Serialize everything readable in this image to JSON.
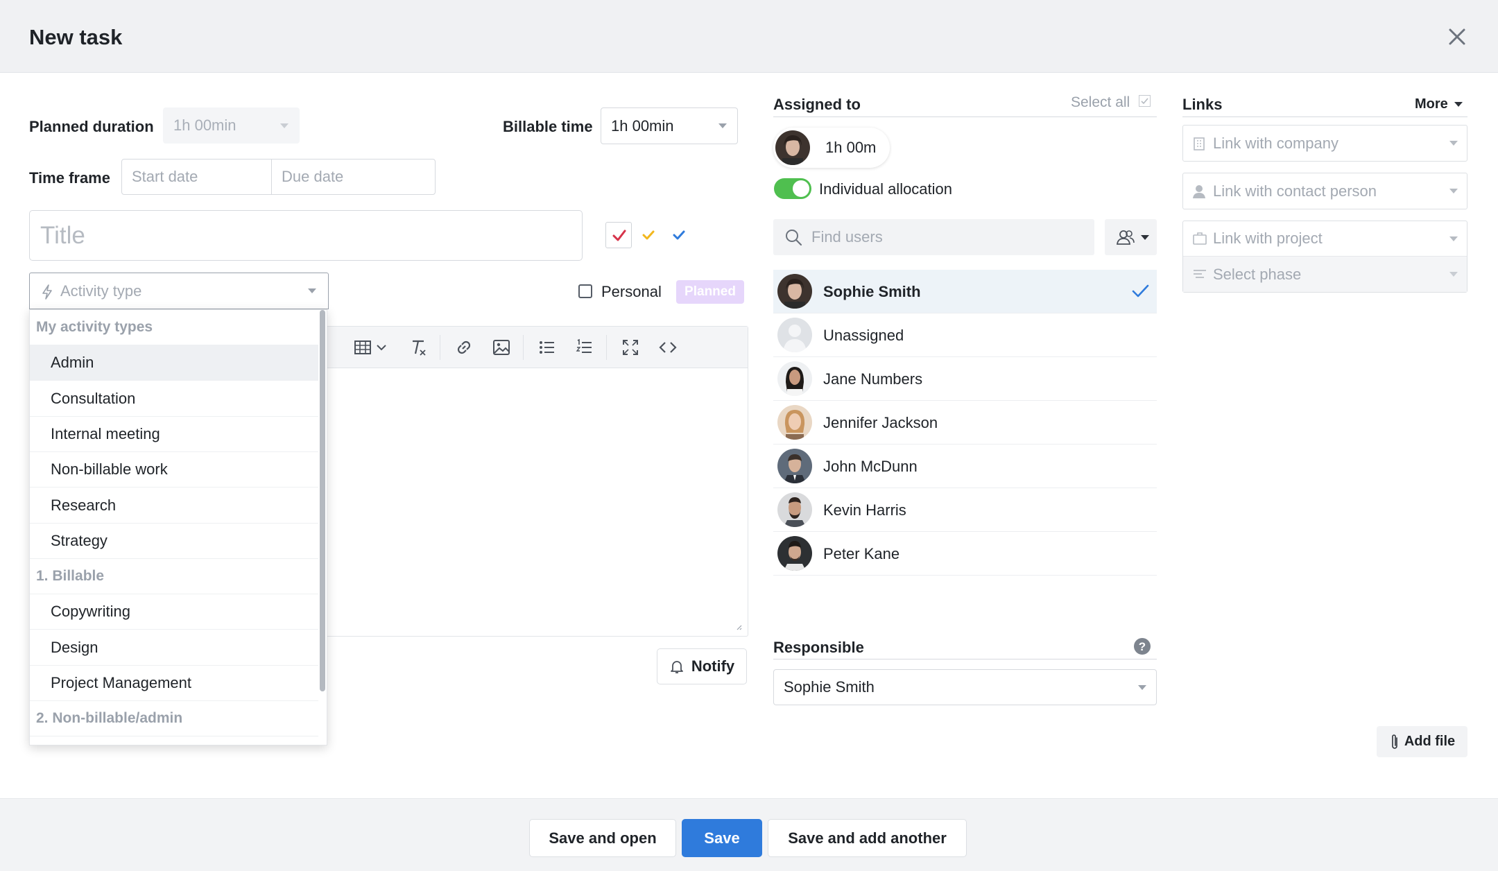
{
  "dialog": {
    "title": "New task"
  },
  "form": {
    "planned_duration": {
      "label": "Planned duration",
      "value": "1h 00min"
    },
    "billable_time": {
      "label": "Billable time",
      "value": "1h 00min"
    },
    "time_frame": {
      "label": "Time frame",
      "start_placeholder": "Start date",
      "due_placeholder": "Due date"
    },
    "title_placeholder": "Title",
    "activity_type_placeholder": "Activity type",
    "personal_label": "Personal",
    "planned_badge": "Planned",
    "notify_label": "Notify",
    "status_colors": {
      "red": "#d6334a",
      "yellow": "#f2b71e",
      "blue": "#2f7bdc"
    }
  },
  "activity_menu": [
    {
      "kind": "group",
      "label": "My activity types"
    },
    {
      "kind": "item",
      "label": "Admin",
      "highlighted": true
    },
    {
      "kind": "item",
      "label": "Consultation"
    },
    {
      "kind": "item",
      "label": "Internal meeting"
    },
    {
      "kind": "item",
      "label": "Non-billable work"
    },
    {
      "kind": "item",
      "label": "Research"
    },
    {
      "kind": "item",
      "label": "Strategy"
    },
    {
      "kind": "group",
      "label": "1. Billable"
    },
    {
      "kind": "item",
      "label": "Copywriting"
    },
    {
      "kind": "item",
      "label": "Design"
    },
    {
      "kind": "item",
      "label": "Project Management"
    },
    {
      "kind": "group",
      "label": "2. Non-billable/admin"
    }
  ],
  "assigned": {
    "label": "Assigned to",
    "select_all": "Select all",
    "chip_time": "1h 00m",
    "individual_allocation": "Individual allocation",
    "find_users_placeholder": "Find users",
    "users": [
      {
        "name": "Sophie Smith",
        "selected": true
      },
      {
        "name": "Unassigned",
        "selected": false
      },
      {
        "name": "Jane Numbers",
        "selected": false
      },
      {
        "name": "Jennifer Jackson",
        "selected": false
      },
      {
        "name": "John McDunn",
        "selected": false
      },
      {
        "name": "Kevin Harris",
        "selected": false
      },
      {
        "name": "Peter Kane",
        "selected": false
      }
    ]
  },
  "responsible": {
    "label": "Responsible",
    "value": "Sophie Smith"
  },
  "links": {
    "label": "Links",
    "more": "More",
    "company": "Link with company",
    "contact": "Link with contact person",
    "project": "Link with project",
    "phase": "Select phase"
  },
  "add_file": "Add file",
  "footer": {
    "save_and_open": "Save and open",
    "save": "Save",
    "save_and_add_another": "Save and add another"
  },
  "colors": {
    "accent": "#2f7bdc",
    "toggle_on": "#4fbf4f",
    "badge": "#e6d6fb"
  }
}
